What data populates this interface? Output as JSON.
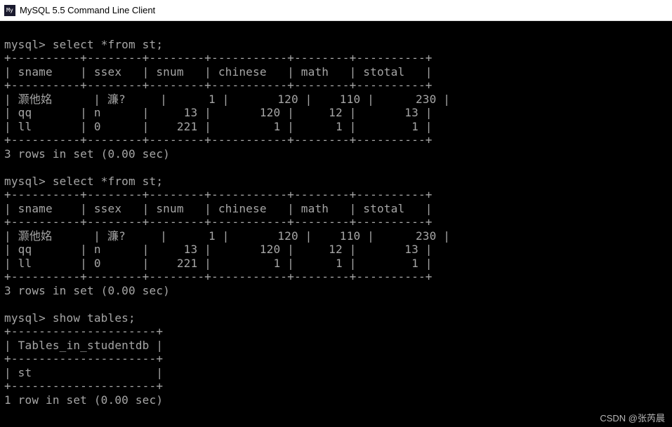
{
  "window": {
    "title": "MySQL 5.5 Command Line Client",
    "icon_label": "MySQL"
  },
  "terminal": {
    "prompt": "mysql>",
    "query1": {
      "command": "select *from st;",
      "headers": [
        "sname",
        "ssex",
        "snum",
        "chinese",
        "math",
        "stotal"
      ],
      "rows": [
        [
          "灏他姳",
          "濂?",
          "1",
          "120",
          "110",
          "230"
        ],
        [
          "qq",
          "n",
          "13",
          "120",
          "12",
          "13"
        ],
        [
          "ll",
          "0",
          "221",
          "1",
          "1",
          "1"
        ]
      ],
      "footer": "3 rows in set (0.00 sec)"
    },
    "query2": {
      "command": "select *from st;",
      "headers": [
        "sname",
        "ssex",
        "snum",
        "chinese",
        "math",
        "stotal"
      ],
      "rows": [
        [
          "灏他姳",
          "濂?",
          "1",
          "120",
          "110",
          "230"
        ],
        [
          "qq",
          "n",
          "13",
          "120",
          "12",
          "13"
        ],
        [
          "ll",
          "0",
          "221",
          "1",
          "1",
          "1"
        ]
      ],
      "footer": "3 rows in set (0.00 sec)"
    },
    "query3": {
      "command": "show tables;",
      "header": "Tables_in_studentdb",
      "rows": [
        "st"
      ],
      "footer": "1 row in set (0.00 sec)"
    },
    "colwidths": {
      "sname": 8,
      "ssex": 6,
      "snum": 6,
      "chinese": 9,
      "math": 6,
      "stotal": 8
    }
  },
  "watermark": "CSDN @张芮晨"
}
